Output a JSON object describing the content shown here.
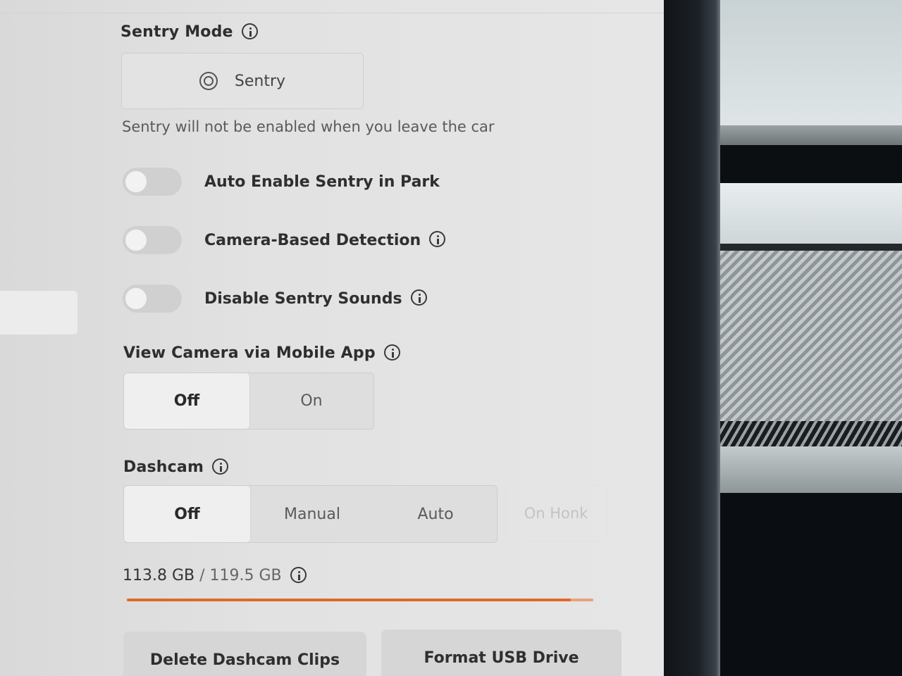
{
  "sentry_mode": {
    "title": "Sentry Mode",
    "button_label": "Sentry",
    "note": "Sentry will not be enabled when you leave the car"
  },
  "toggles": [
    {
      "label": "Auto Enable Sentry in Park",
      "on": false
    },
    {
      "label": "Camera-Based Detection",
      "on": false
    },
    {
      "label": "Disable Sentry Sounds",
      "on": false
    }
  ],
  "view_camera": {
    "title": "View Camera via Mobile App",
    "options": [
      "Off",
      "On"
    ],
    "selected": "Off"
  },
  "dashcam": {
    "title": "Dashcam",
    "options": [
      "Off",
      "Manual",
      "Auto"
    ],
    "disabled_option": "On Honk",
    "selected": "Off"
  },
  "storage": {
    "used": "113.8 GB",
    "total": "/ 119.5 GB",
    "fill_fraction": 0.952,
    "accent_color": "#e0682b"
  },
  "actions": {
    "delete_label": "Delete Dashcam Clips",
    "format_label": "Format USB Drive"
  }
}
